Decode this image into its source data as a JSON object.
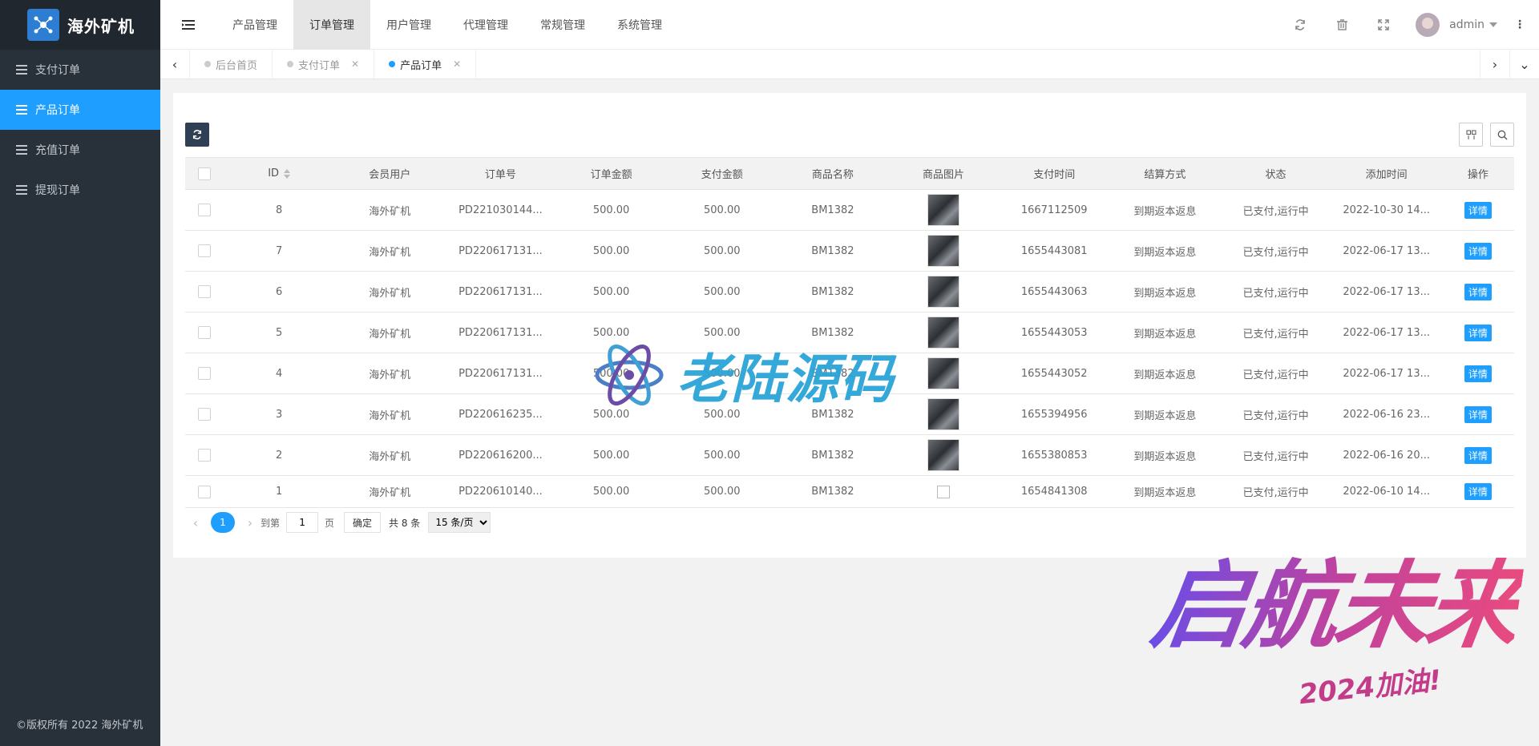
{
  "app": {
    "title": "海外矿机",
    "copyright": "©版权所有 2022 海外矿机"
  },
  "sidebar": {
    "items": [
      {
        "label": "支付订单",
        "active": false
      },
      {
        "label": "产品订单",
        "active": true
      },
      {
        "label": "充值订单",
        "active": false
      },
      {
        "label": "提现订单",
        "active": false
      }
    ]
  },
  "header": {
    "nav": [
      {
        "label": "产品管理",
        "active": false
      },
      {
        "label": "订单管理",
        "active": true
      },
      {
        "label": "用户管理",
        "active": false
      },
      {
        "label": "代理管理",
        "active": false
      },
      {
        "label": "常规管理",
        "active": false
      },
      {
        "label": "系统管理",
        "active": false
      }
    ],
    "icons": [
      "refresh-icon",
      "trash-icon",
      "fullscreen-icon"
    ],
    "user": "admin"
  },
  "tabs": [
    {
      "label": "后台首页",
      "active": false,
      "closable": false
    },
    {
      "label": "支付订单",
      "active": false,
      "closable": true
    },
    {
      "label": "产品订单",
      "active": true,
      "closable": true
    }
  ],
  "table": {
    "columns": [
      "ID",
      "会员用户",
      "订单号",
      "订单金额",
      "支付金额",
      "商品名称",
      "商品图片",
      "支付时间",
      "结算方式",
      "状态",
      "添加时间",
      "操作"
    ],
    "action_label": "详情",
    "rows": [
      {
        "id": "8",
        "user": "海外矿机",
        "order_no": "PD221030144...",
        "amount": "500.00",
        "paid": "500.00",
        "product": "BM1382",
        "image": "ok",
        "pay_time": "1667112509",
        "settle": "到期返本返息",
        "status": "已支付,运行中",
        "added": "2022-10-30 14..."
      },
      {
        "id": "7",
        "user": "海外矿机",
        "order_no": "PD220617131...",
        "amount": "500.00",
        "paid": "500.00",
        "product": "BM1382",
        "image": "ok",
        "pay_time": "1655443081",
        "settle": "到期返本返息",
        "status": "已支付,运行中",
        "added": "2022-06-17 13..."
      },
      {
        "id": "6",
        "user": "海外矿机",
        "order_no": "PD220617131...",
        "amount": "500.00",
        "paid": "500.00",
        "product": "BM1382",
        "image": "ok",
        "pay_time": "1655443063",
        "settle": "到期返本返息",
        "status": "已支付,运行中",
        "added": "2022-06-17 13..."
      },
      {
        "id": "5",
        "user": "海外矿机",
        "order_no": "PD220617131...",
        "amount": "500.00",
        "paid": "500.00",
        "product": "BM1382",
        "image": "ok",
        "pay_time": "1655443053",
        "settle": "到期返本返息",
        "status": "已支付,运行中",
        "added": "2022-06-17 13..."
      },
      {
        "id": "4",
        "user": "海外矿机",
        "order_no": "PD220617131...",
        "amount": "500.00",
        "paid": "500.00",
        "product": "BM1382",
        "image": "ok",
        "pay_time": "1655443052",
        "settle": "到期返本返息",
        "status": "已支付,运行中",
        "added": "2022-06-17 13..."
      },
      {
        "id": "3",
        "user": "海外矿机",
        "order_no": "PD220616235...",
        "amount": "500.00",
        "paid": "500.00",
        "product": "BM1382",
        "image": "ok",
        "pay_time": "1655394956",
        "settle": "到期返本返息",
        "status": "已支付,运行中",
        "added": "2022-06-16 23..."
      },
      {
        "id": "2",
        "user": "海外矿机",
        "order_no": "PD220616200...",
        "amount": "500.00",
        "paid": "500.00",
        "product": "BM1382",
        "image": "ok",
        "pay_time": "1655380853",
        "settle": "到期返本返息",
        "status": "已支付,运行中",
        "added": "2022-06-16 20..."
      },
      {
        "id": "1",
        "user": "海外矿机",
        "order_no": "PD220610140...",
        "amount": "500.00",
        "paid": "500.00",
        "product": "BM1382",
        "image": "broken",
        "pay_time": "1654841308",
        "settle": "到期返本返息",
        "status": "已支付,运行中",
        "added": "2022-06-10 14..."
      }
    ]
  },
  "pagination": {
    "current": "1",
    "goto_label": "到第",
    "goto_value": "1",
    "page_label": "页",
    "confirm_label": "确定",
    "total_label": "共 8 条",
    "page_size": "15 条/页"
  },
  "watermarks": {
    "center": "老陆源码",
    "corner_big": "启航未来",
    "corner_small": "2024加油!"
  },
  "colors": {
    "accent": "#1e9fff",
    "sidebar": "#28313a",
    "logo_bg": "#20272f",
    "refresh_btn": "#2f4056"
  }
}
